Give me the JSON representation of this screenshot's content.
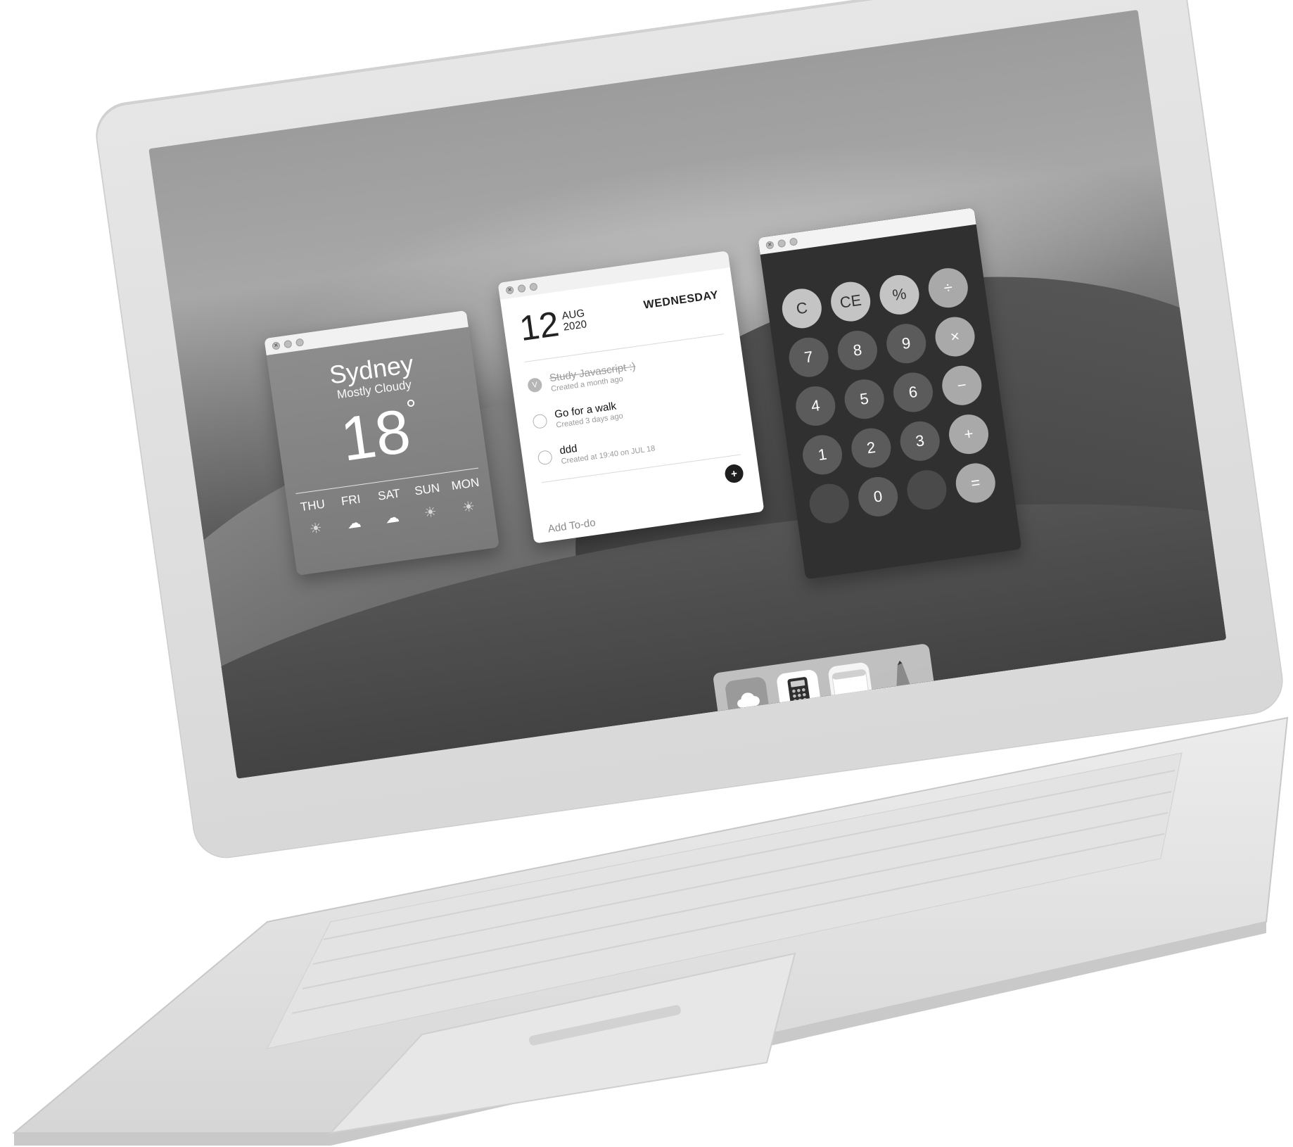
{
  "weather": {
    "city": "Sydney",
    "condition": "Mostly Cloudy",
    "temperature": "18",
    "degree": "°",
    "forecast": [
      {
        "day": "THU",
        "icon": "sun-icon"
      },
      {
        "day": "FRI",
        "icon": "rain-cloud-icon"
      },
      {
        "day": "SAT",
        "icon": "rain-cloud-icon"
      },
      {
        "day": "SUN",
        "icon": "sun-icon"
      },
      {
        "day": "MON",
        "icon": "sun-icon"
      }
    ]
  },
  "todo": {
    "day": "12",
    "month": "AUG",
    "year": "2020",
    "weekday": "WEDNESDAY",
    "tasks": [
      {
        "title": "Study Javascript :)",
        "subtitle": "Created a month ago",
        "done": true,
        "check_mark": "V"
      },
      {
        "title": "Go for a walk",
        "subtitle": "Created 3 days ago",
        "done": false
      },
      {
        "title": "ddd",
        "subtitle": "Created at 19:40 on JUL 18",
        "done": false
      }
    ],
    "add_button": "+",
    "add_label": "Add To-do"
  },
  "calculator": {
    "keys": [
      "C",
      "CE",
      "%",
      "÷",
      "7",
      "8",
      "9",
      "×",
      "4",
      "5",
      "6",
      "−",
      "1",
      "2",
      "3",
      "+",
      "",
      "0",
      "",
      "="
    ]
  },
  "dock": {
    "apps": [
      {
        "icon": "weather-cloud-icon",
        "running": true
      },
      {
        "icon": "calculator-icon",
        "running": true
      },
      {
        "icon": "notes-icon",
        "running": true
      },
      {
        "icon": "pencil-icon",
        "running": false
      }
    ]
  },
  "window_controls": {
    "close": "×"
  },
  "colors": {
    "dock": "#cdcdcd",
    "calculator_bg": "#303030",
    "weather_bg": "#8e8e8e"
  }
}
